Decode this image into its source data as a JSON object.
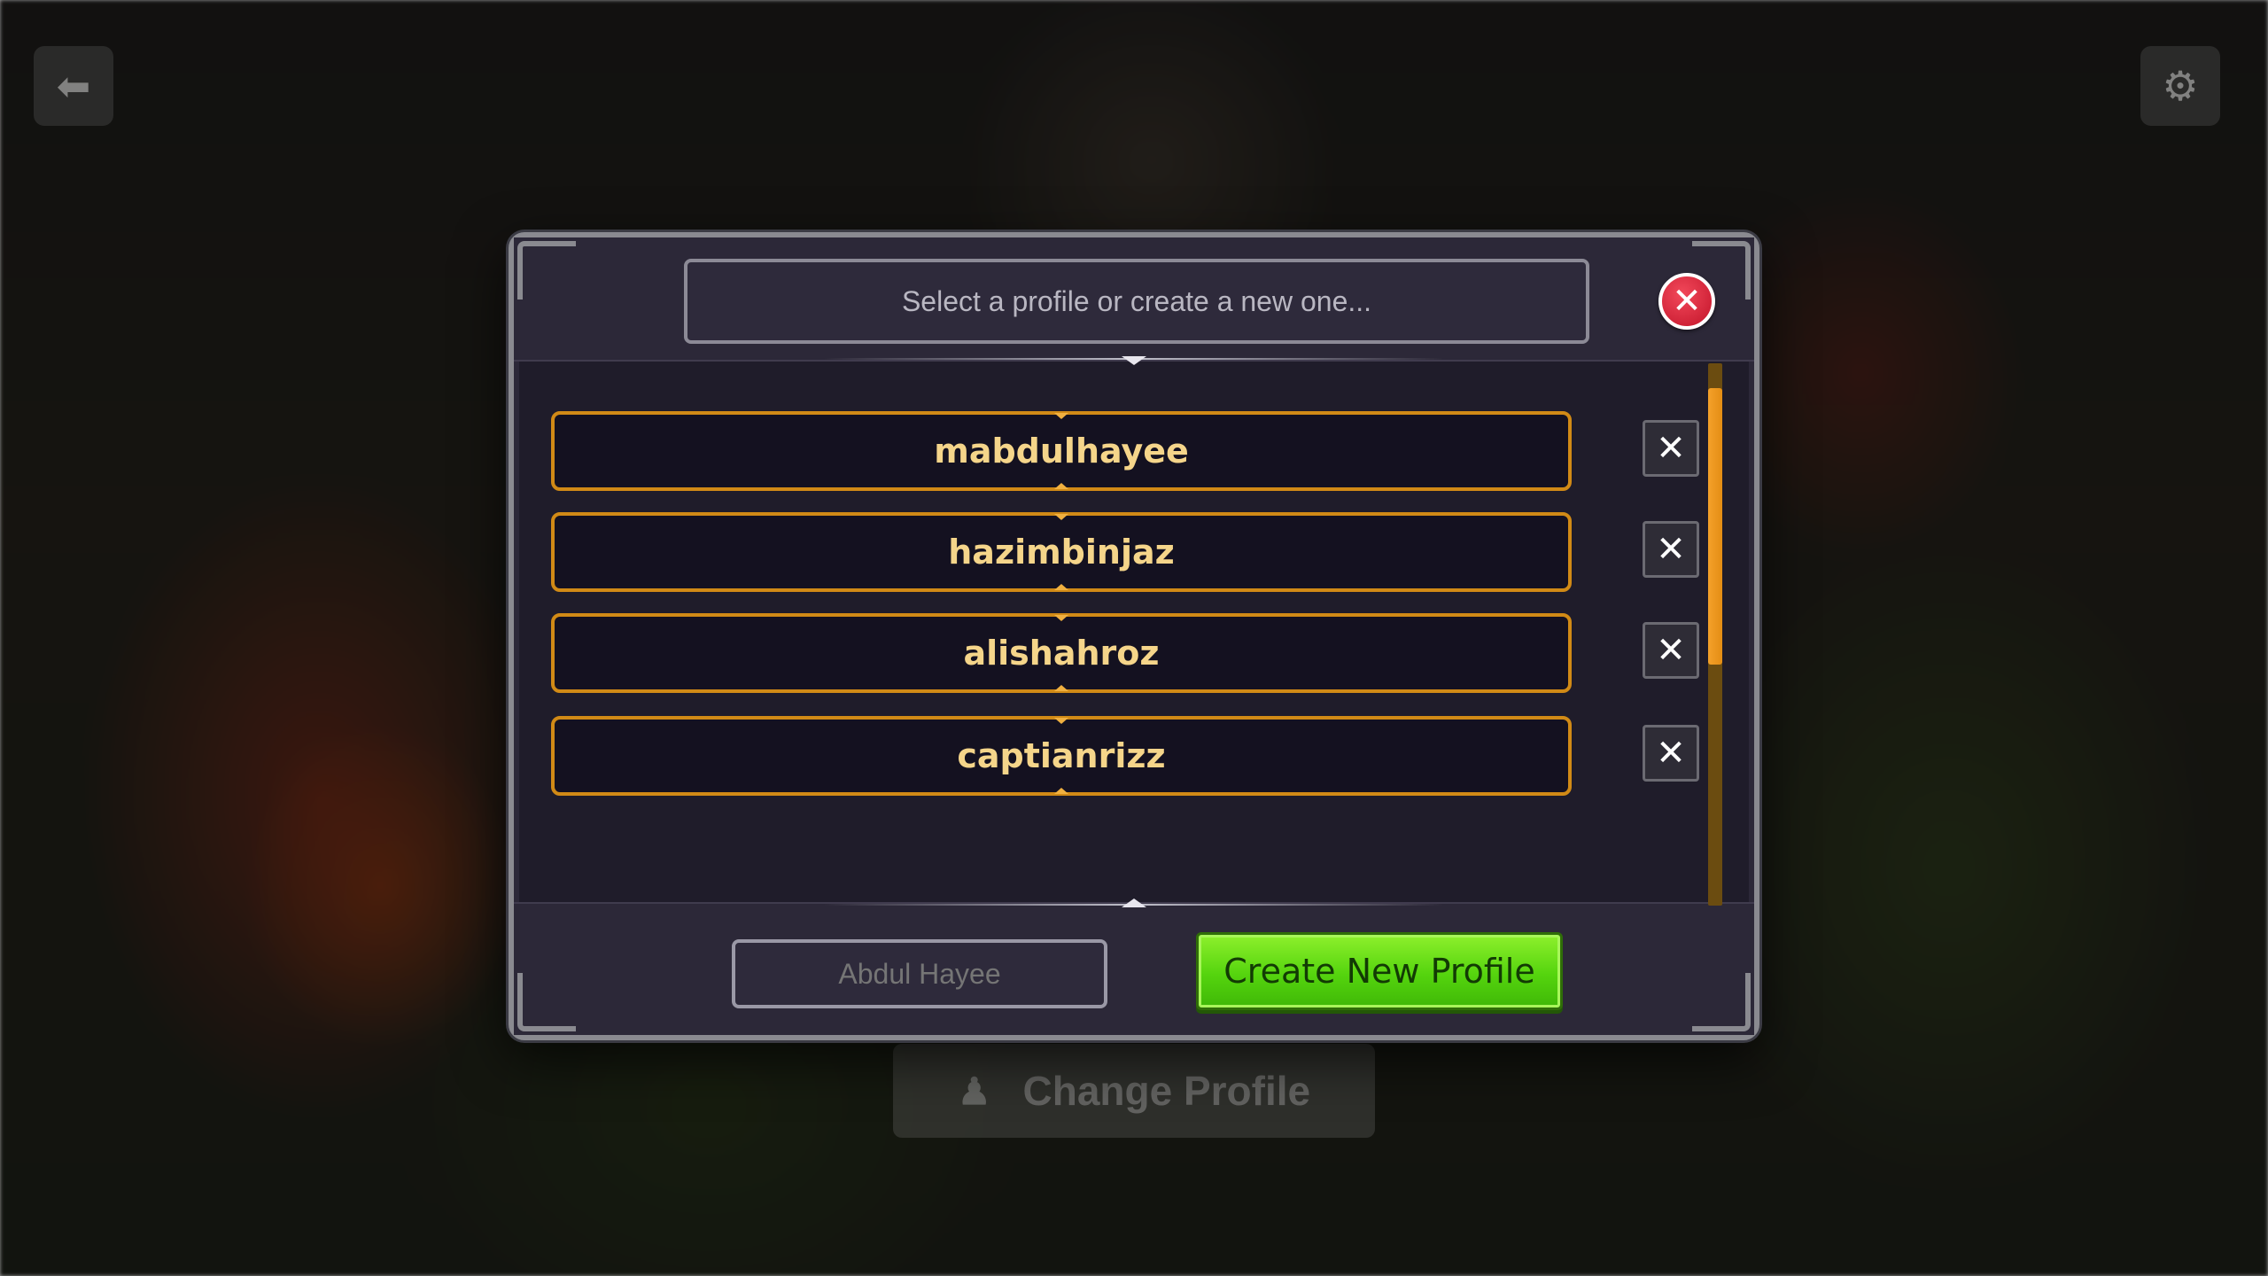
{
  "background": {
    "change_profile_label": "Change Profile"
  },
  "dialog": {
    "search": {
      "placeholder": "Select a profile or create a new one..."
    },
    "close_glyph": "✕",
    "delete_glyph": "✕",
    "profiles": [
      {
        "name": "mabdulhayee"
      },
      {
        "name": "hazimbinjaz"
      },
      {
        "name": "alishahroz"
      },
      {
        "name": "captianrizz"
      }
    ],
    "scroll_position": 0.0,
    "name_input": {
      "placeholder": "Abdul Hayee"
    },
    "create_button_label": "Create New Profile"
  },
  "colors": {
    "accent_orange": "#d18a16",
    "profile_text": "#f5d58a",
    "create_green": "#55d40e",
    "close_red": "#d81e36"
  }
}
